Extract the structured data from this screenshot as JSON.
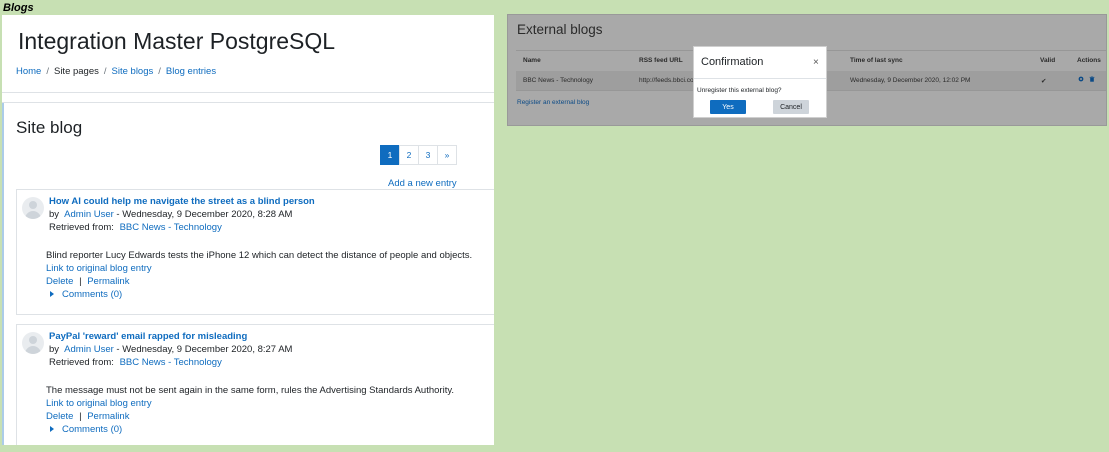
{
  "corner_label": "Blogs",
  "header": {
    "title": "Integration Master PostgreSQL",
    "breadcrumb": [
      "Home",
      "Site pages",
      "Site blogs",
      "Blog entries"
    ],
    "breadcrumb_sep": "/"
  },
  "main": {
    "title": "Site blog",
    "pagination": [
      "1",
      "2",
      "3",
      "»"
    ],
    "active_page": "1",
    "add_entry": "Add a new entry",
    "entries": [
      {
        "title": "How AI could help me navigate the street as a blind person",
        "by_prefix": "by",
        "author": "Admin User",
        "date": " - Wednesday, 9 December 2020, 8:28 AM",
        "retrieved_prefix": "Retrieved from:",
        "source": "BBC News - Technology",
        "summary": "Blind reporter Lucy Edwards tests the iPhone 12 which can detect the distance of people and objects.",
        "link_original": "Link to original blog entry",
        "delete": "Delete",
        "pipe": "|",
        "permalink": "Permalink",
        "comments": "Comments (0)"
      },
      {
        "title": "PayPal 'reward' email rapped for misleading",
        "by_prefix": "by",
        "author": "Admin User",
        "date": " - Wednesday, 9 December 2020, 8:27 AM",
        "retrieved_prefix": "Retrieved from:",
        "source": "BBC News - Technology",
        "summary": "The message must not be sent again in the same form, rules the Advertising Standards Authority.",
        "link_original": "Link to original blog entry",
        "delete": "Delete",
        "pipe": "|",
        "permalink": "Permalink",
        "comments": "Comments (0)"
      }
    ]
  },
  "external": {
    "title": "External blogs",
    "columns": [
      "Name",
      "RSS feed URL",
      "Time of last sync",
      "Valid",
      "Actions"
    ],
    "row": {
      "name": "BBC News - Technology",
      "url": "http://feeds.bbci.co",
      "last_sync": "Wednesday, 9 December 2020, 12:02 PM",
      "valid": "✔"
    },
    "register_link": "Register an external blog"
  },
  "modal": {
    "title": "Confirmation",
    "close": "×",
    "body": "Unregister this external blog?",
    "yes": "Yes",
    "cancel": "Cancel"
  },
  "colors": {
    "accent": "#0f6cbf",
    "background": "#c7e0b3",
    "overlay": "#a9a9a9"
  }
}
